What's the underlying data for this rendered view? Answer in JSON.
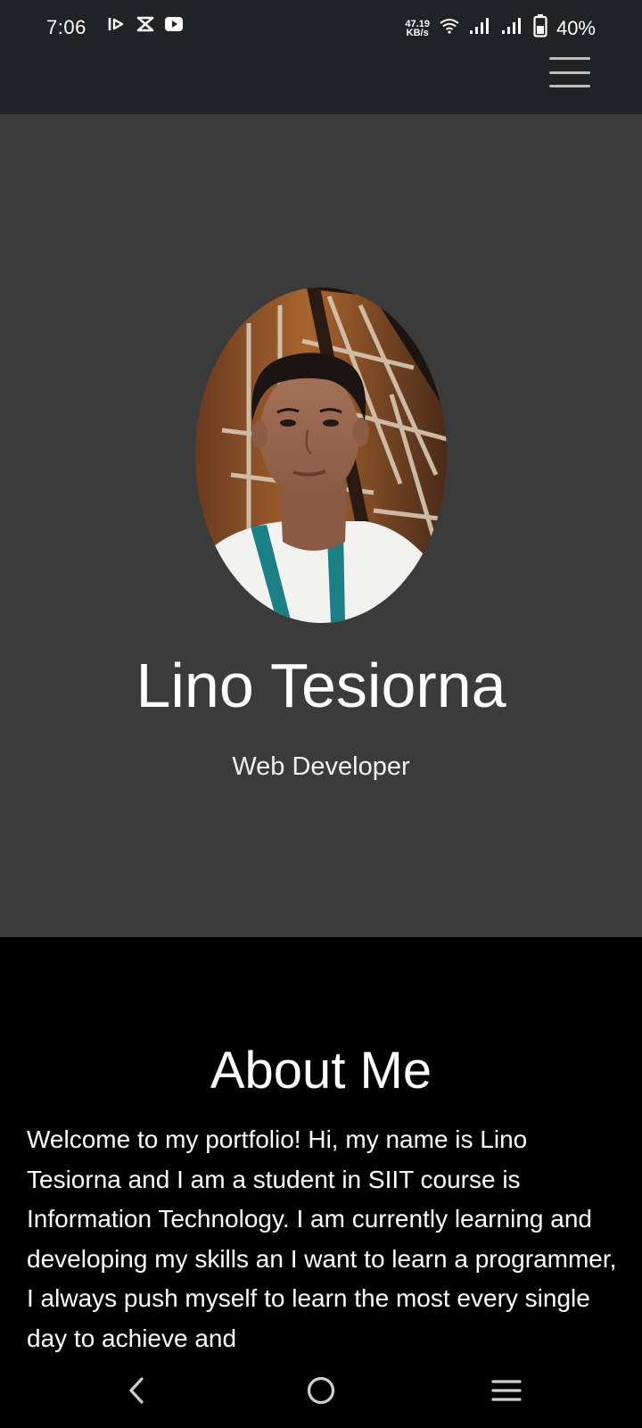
{
  "status_bar": {
    "time": "7:06",
    "net_speed_value": "47.19",
    "net_speed_unit": "KB/s",
    "battery_percent": "40%",
    "left_icons": [
      "bilibili-icon",
      "capcut-icon",
      "youtube-icon"
    ],
    "right_icons": [
      "wifi-icon",
      "signal-icon",
      "signal-icon",
      "battery-icon"
    ]
  },
  "navbar": {
    "menu_icon": "hamburger-menu-icon"
  },
  "hero": {
    "avatar_alt": "profile-photo",
    "name": "Lino Tesiorna",
    "role": "Web Developer"
  },
  "about": {
    "title": "About Me",
    "text": "Welcome to my portfolio! Hi, my name is Lino Tesiorna and I am a student in SIIT course is Information Technology. I am currently learning and developing my skills an I want to learn a programmer, I always push myself to learn the most every single day to achieve and"
  },
  "system_nav": {
    "icons": [
      "back-icon",
      "home-icon",
      "recent-apps-icon"
    ]
  },
  "colors": {
    "status_bar_bg": "#202224",
    "hero_bg": "#3b3b3b",
    "about_bg": "#000000",
    "text": "#ffffff"
  }
}
